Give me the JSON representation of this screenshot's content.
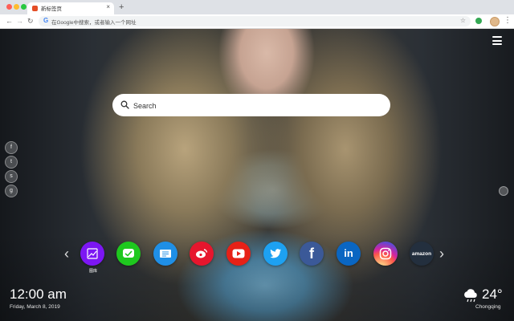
{
  "browser": {
    "tab_title": "新标签页",
    "tab_close": "×",
    "new_tab": "+",
    "omnibox_text": "在Google中搜索，或者输入一个网址",
    "google_g": "G",
    "nav": {
      "back": "←",
      "forward": "→",
      "reload": "↻",
      "star": "☆",
      "menu": "⋮"
    }
  },
  "search": {
    "placeholder": "Search"
  },
  "social_links": [
    "f",
    "t",
    "s",
    "g"
  ],
  "dock": {
    "left_arrow": "‹",
    "right_arrow": "›",
    "apps": [
      {
        "name": "gallery",
        "label": "图库",
        "color": "#7c16f3"
      },
      {
        "name": "wechat",
        "label": "",
        "color": "#1ec81e"
      },
      {
        "name": "notes",
        "label": "",
        "color": "#1f8fe6"
      },
      {
        "name": "weibo",
        "label": "",
        "color": "#e6162d"
      },
      {
        "name": "youtube",
        "label": "",
        "color": "#e62117"
      },
      {
        "name": "twitter",
        "label": "",
        "color": "#1da1f2"
      },
      {
        "name": "facebook",
        "label": "",
        "color": "#3b5998"
      },
      {
        "name": "linkedin",
        "label": "",
        "color": "#0a66c2"
      },
      {
        "name": "instagram",
        "label": "",
        "color": "#c13584"
      },
      {
        "name": "amazon",
        "label": "amazon",
        "color": "#232f3e"
      }
    ]
  },
  "clock": {
    "time": "12:00 am",
    "date": "Friday, March 8, 2019"
  },
  "weather": {
    "temp": "24°",
    "city": "Chongqing",
    "icon": "cloud-rain-icon"
  }
}
